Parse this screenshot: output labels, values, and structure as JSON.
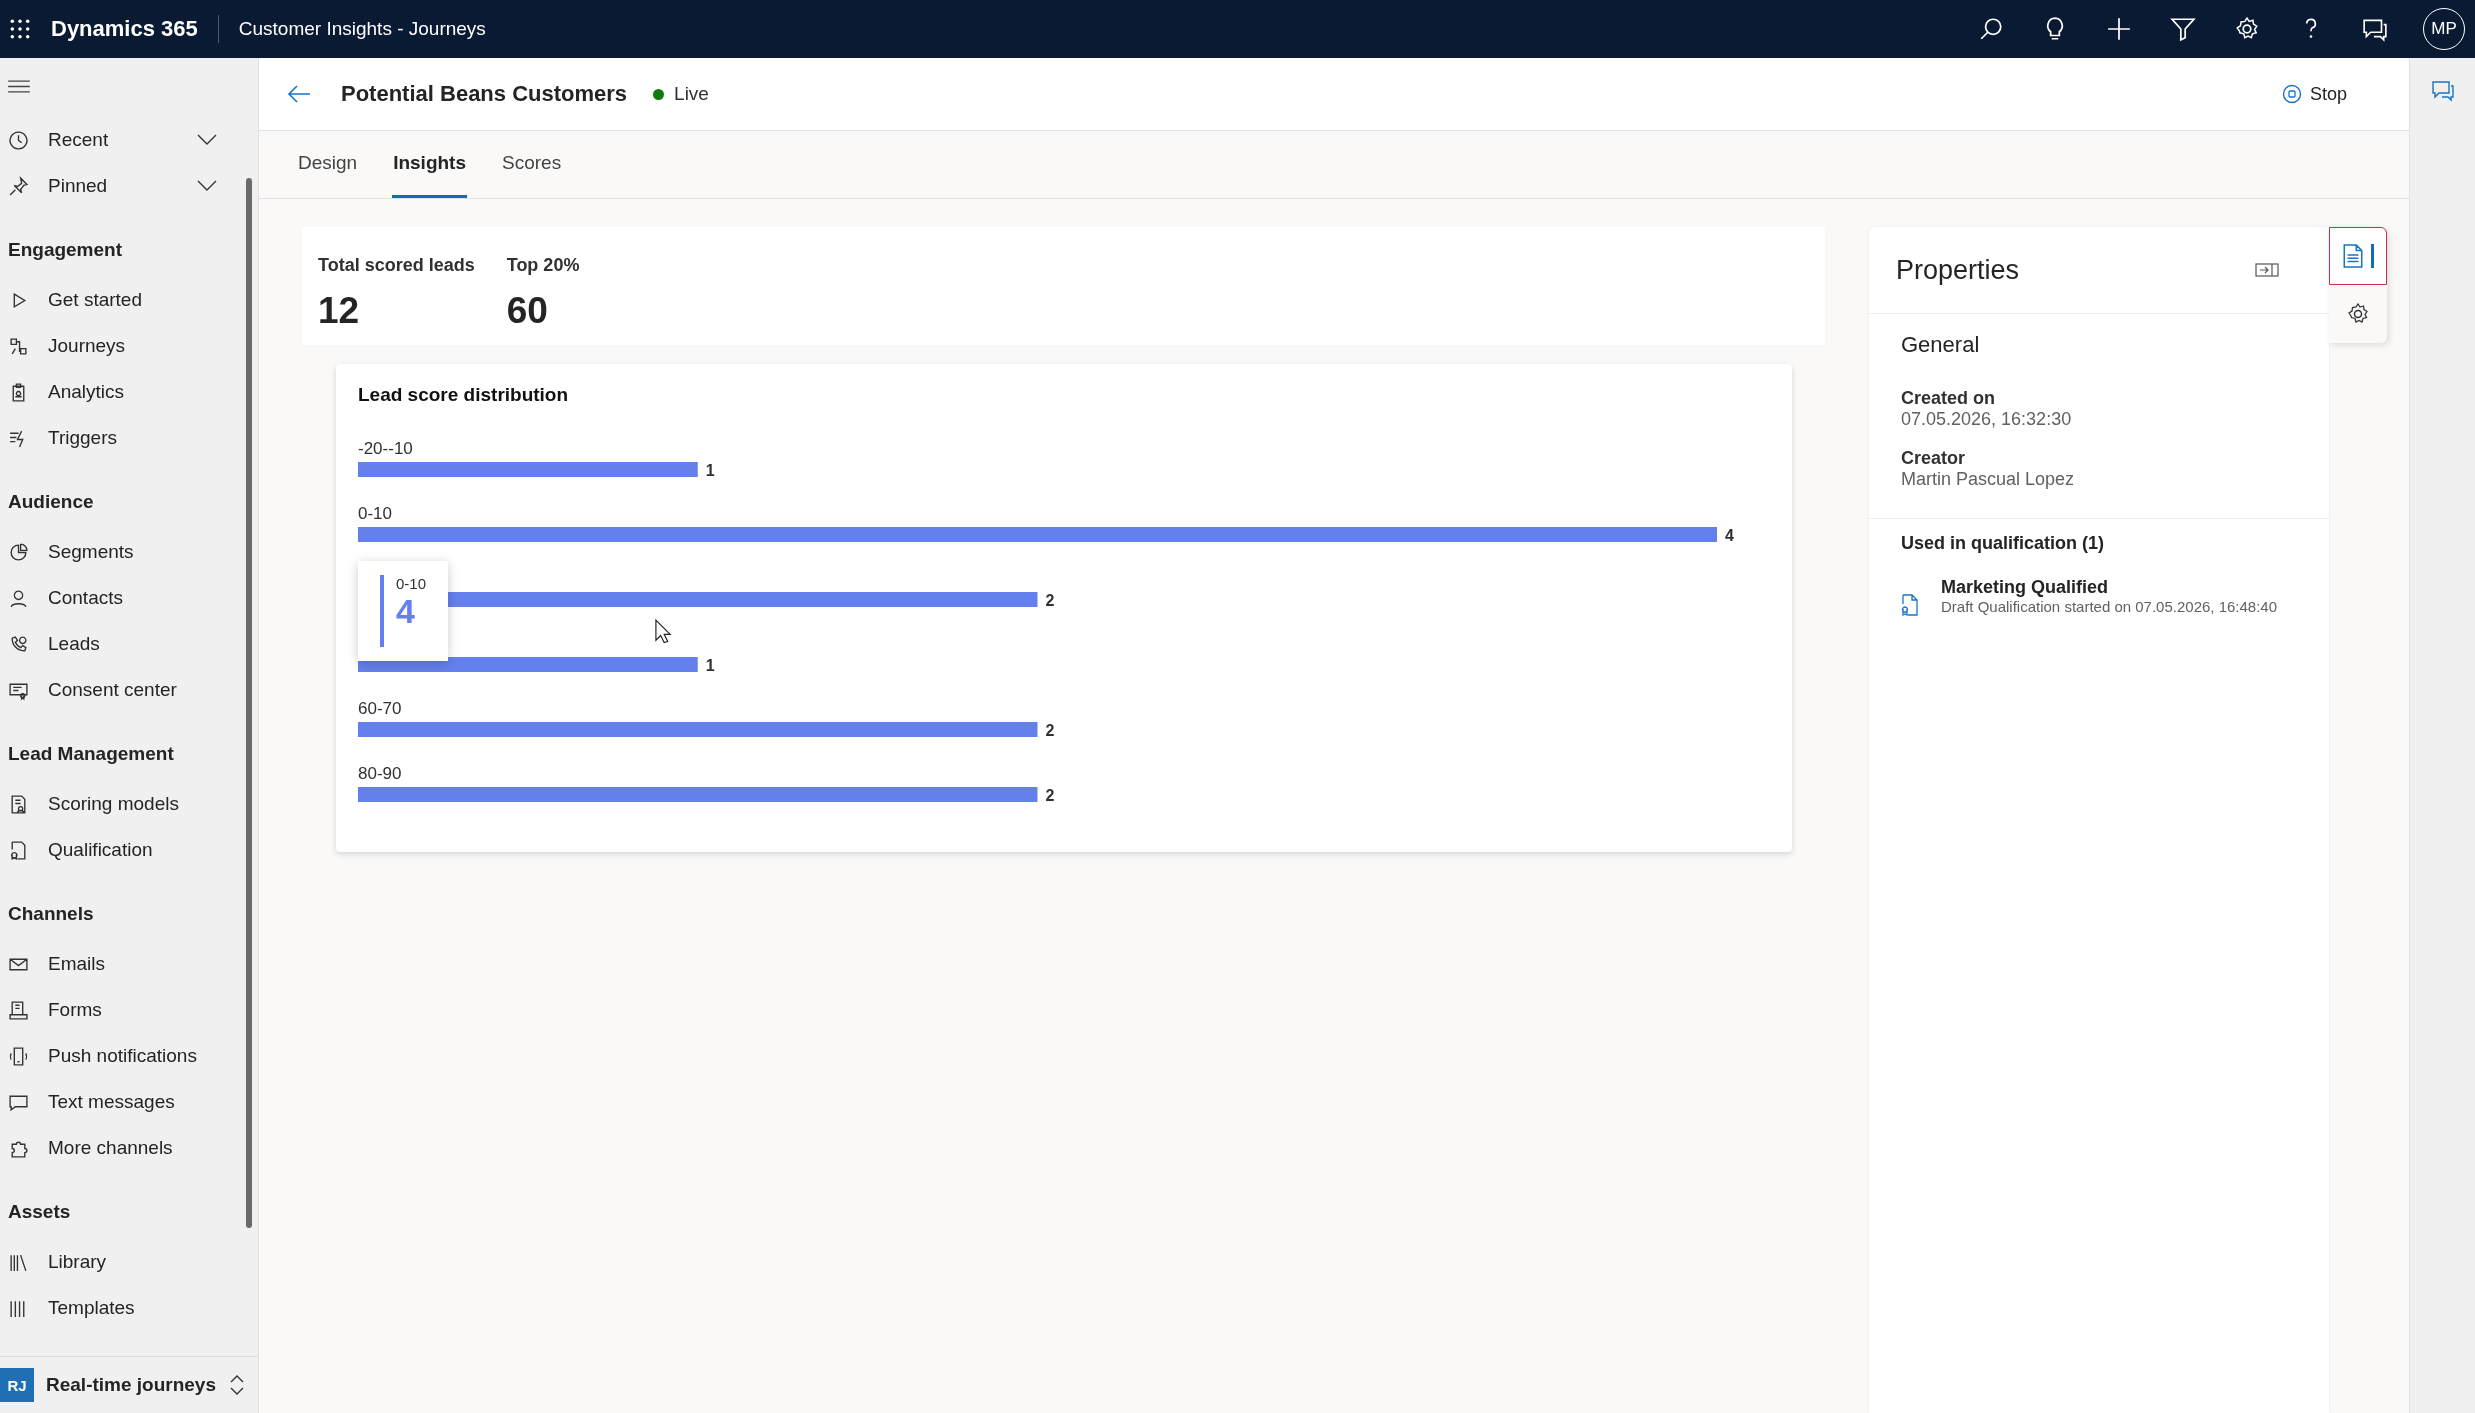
{
  "app_bar": {
    "app_name": "Dynamics 365",
    "area": "Customer Insights - Journeys",
    "avatar": "MP"
  },
  "sidebar": {
    "top_items": [
      {
        "label": "Recent",
        "expanded": false
      },
      {
        "label": "Pinned",
        "expanded": false
      }
    ],
    "groups": [
      {
        "title": "Engagement",
        "items": [
          {
            "label": "Get started",
            "selected": false
          },
          {
            "label": "Journeys",
            "selected": false
          },
          {
            "label": "Analytics",
            "selected": false
          },
          {
            "label": "Triggers",
            "selected": false
          }
        ]
      },
      {
        "title": "Audience",
        "items": [
          {
            "label": "Segments",
            "selected": false
          },
          {
            "label": "Contacts",
            "selected": false
          },
          {
            "label": "Leads",
            "selected": false
          },
          {
            "label": "Consent center",
            "selected": false
          }
        ]
      },
      {
        "title": "Lead Management",
        "items": [
          {
            "label": "Scoring models",
            "selected": false
          },
          {
            "label": "Qualification",
            "selected": false
          }
        ]
      },
      {
        "title": "Channels",
        "items": [
          {
            "label": "Emails",
            "selected": false
          },
          {
            "label": "Forms",
            "selected": false
          },
          {
            "label": "Push notifications",
            "selected": false
          },
          {
            "label": "Text messages",
            "selected": false
          },
          {
            "label": "More channels",
            "selected": false
          }
        ]
      },
      {
        "title": "Assets",
        "items": [
          {
            "label": "Library",
            "selected": false
          },
          {
            "label": "Templates",
            "selected": false
          }
        ]
      }
    ],
    "area_switcher": {
      "badge": "RJ",
      "label": "Real-time journeys"
    }
  },
  "header": {
    "title": "Potential Beans Customers",
    "status": "Live",
    "stop_button": "Stop"
  },
  "tabs": [
    {
      "label": "Design",
      "selected": false
    },
    {
      "label": "Insights",
      "selected": true
    },
    {
      "label": "Scores",
      "selected": false
    }
  ],
  "stats": [
    {
      "label": "Total scored leads",
      "value": "12"
    },
    {
      "label": "Top 20%",
      "value": "60"
    }
  ],
  "chart": {
    "title": "Lead score distribution",
    "chart_data": {
      "type": "bar",
      "orientation": "horizontal",
      "categories": [
        "-20--10",
        "0-10",
        null,
        null,
        "60-70",
        "80-90"
      ],
      "series": [
        {
          "color": "#6480ec",
          "values": [
            1,
            4,
            2,
            1,
            2,
            2
          ]
        }
      ],
      "data_labels": true
    },
    "tooltip": {
      "label": "0-10",
      "value": "4"
    }
  },
  "properties": {
    "title": "Properties",
    "section": "General",
    "fields": [
      {
        "label": "Created on",
        "value": "07.05.2026, 16:32:30"
      },
      {
        "label": "Creator",
        "value": "Martin Pascual Lopez"
      }
    ],
    "qualification_heading": "Used in qualification (1)",
    "qualifications": [
      {
        "name": "Marketing Qualified",
        "detail": "Draft Qualification started on 07.05.2026, 16:48:40"
      }
    ]
  },
  "side_tabs": [
    {
      "selected": true
    },
    {
      "selected": false
    }
  ]
}
